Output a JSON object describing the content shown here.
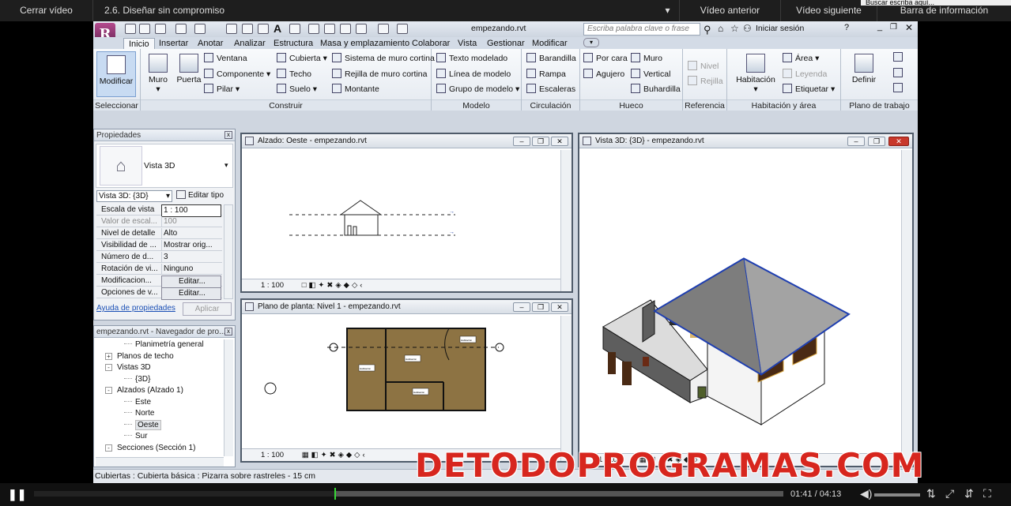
{
  "player_top": {
    "close_video": "Cerrar vídeo",
    "lesson_title": "2.6.  Diseñar sin compromiso",
    "prev_video": "Vídeo anterior",
    "next_video": "Vídeo siguiente",
    "info_bar": "Barra de información",
    "tooltip_fragment": "Buscar escriba aquí..."
  },
  "revit": {
    "file_name": "empezando.rvt",
    "search_placeholder": "Escriba palabra clave o frase",
    "sign_in": "Iniciar sesión",
    "tabs": [
      "Inicio",
      "Insertar",
      "Anotar",
      "Analizar",
      "Estructura",
      "Masa y emplazamiento",
      "Colaborar",
      "Vista",
      "Gestionar",
      "Modificar"
    ],
    "groups": {
      "seleccionar": "Seleccionar",
      "construir": "Construir",
      "modelo": "Modelo",
      "circulacion": "Circulación",
      "hueco": "Hueco",
      "referencia": "Referencia",
      "habitacion_area": "Habitación y área",
      "plano_trabajo": "Plano de trabajo"
    },
    "buttons": {
      "modificar": "Modificar",
      "muro": "Muro",
      "puerta": "Puerta",
      "ventana": "Ventana",
      "componente": "Componente",
      "pilar": "Pilar",
      "cubierta": "Cubierta",
      "techo": "Techo",
      "suelo": "Suelo",
      "sistema_muro_cortina": "Sistema de muro cortina",
      "rejilla_muro_cortina": "Rejilla de muro cortina",
      "montante": "Montante",
      "texto_modelado": "Texto modelado",
      "linea_modelo": "Línea de modelo",
      "grupo_modelo": "Grupo de modelo",
      "barandilla": "Barandilla",
      "rampa": "Rampa",
      "escaleras": "Escaleras",
      "por_cara": "Por cara",
      "agujero": "Agujero",
      "muro_hueco": "Muro",
      "vertical": "Vertical",
      "buhardilla": "Buhardilla",
      "nivel": "Nivel",
      "rejilla": "Rejilla",
      "habitacion": "Habitación",
      "area": "Área",
      "leyenda": "Leyenda",
      "etiquetar": "Etiquetar",
      "definir": "Definir"
    },
    "properties": {
      "title": "Propiedades",
      "type_name": "Vista 3D",
      "instance_selector": "Vista 3D: {3D}",
      "edit_type": "Editar tipo",
      "rows": [
        {
          "key": "Escala de vista",
          "value": "1 : 100"
        },
        {
          "key": "Valor de escal...",
          "value": "100"
        },
        {
          "key": "Nivel de detalle",
          "value": "Alto"
        },
        {
          "key": "Visibilidad de ...",
          "value": "Mostrar orig..."
        },
        {
          "key": "Número de d...",
          "value": "3"
        },
        {
          "key": "Rotación de vi...",
          "value": "Ninguno"
        },
        {
          "key": "Modificacion...",
          "value": "Editar..."
        },
        {
          "key": "Opciones de v...",
          "value": "Editar..."
        }
      ],
      "help_link": "Ayuda de propiedades",
      "apply": "Aplicar"
    },
    "browser": {
      "title": "empezando.rvt - Navegador de pro...",
      "items": [
        {
          "label": "Planimetría general",
          "indent": 3,
          "toggle": ""
        },
        {
          "label": "Planos de techo",
          "indent": 1,
          "toggle": "+"
        },
        {
          "label": "Vistas 3D",
          "indent": 1,
          "toggle": "-"
        },
        {
          "label": "{3D}",
          "indent": 3,
          "toggle": ""
        },
        {
          "label": "Alzados (Alzado 1)",
          "indent": 1,
          "toggle": "-"
        },
        {
          "label": "Este",
          "indent": 3,
          "toggle": ""
        },
        {
          "label": "Norte",
          "indent": 3,
          "toggle": ""
        },
        {
          "label": "Oeste",
          "indent": 3,
          "toggle": ""
        },
        {
          "label": "Sur",
          "indent": 3,
          "toggle": ""
        },
        {
          "label": "Secciones (Sección  1)",
          "indent": 1,
          "toggle": "-"
        }
      ]
    },
    "views": {
      "elevation_title": "Alzado: Oeste - empezando.rvt",
      "plan_title": "Plano de planta: Nivel 1 - empezando.rvt",
      "threed_title": "Vista 3D: {3D} - empezando.rvt",
      "scale": "1 : 100",
      "room_label": "Habitación"
    },
    "status_text": "Cubiertas : Cubierta básica : Pizarra sobre rastreles - 15 cm"
  },
  "watermark": "DETODOPROGRAMAS.COM",
  "player_bottom": {
    "time": "01:41 / 04:13",
    "progress": 0.402
  }
}
